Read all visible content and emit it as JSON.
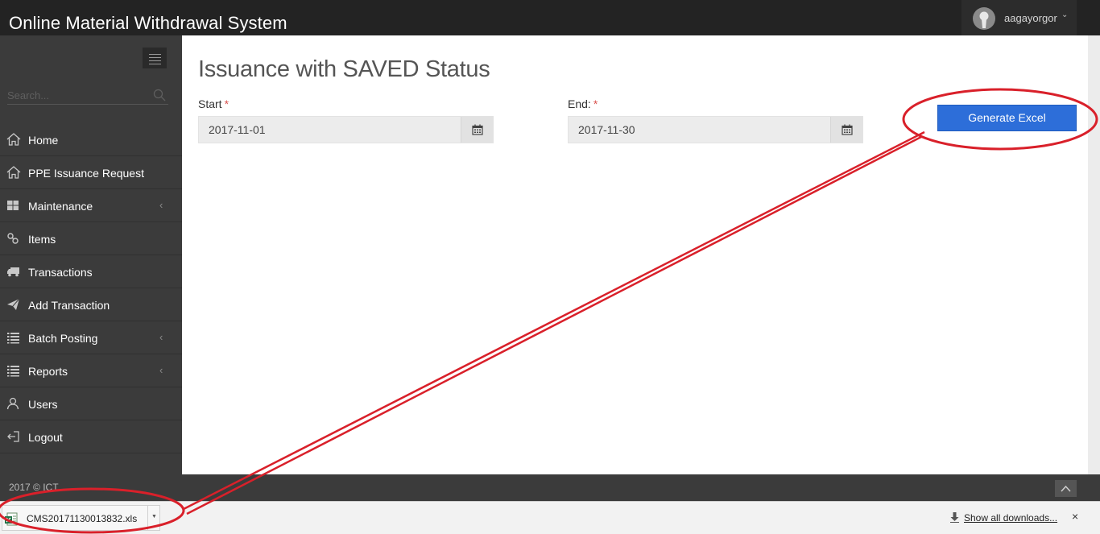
{
  "app_title": "Online Material Withdrawal System",
  "user": {
    "name": "aagayorgor"
  },
  "sidebar": {
    "search_placeholder": "Search...",
    "items": [
      {
        "label": "Home",
        "icon": "home-icon",
        "has_submenu": false
      },
      {
        "label": "PPE Issuance Request",
        "icon": "home-icon",
        "has_submenu": false
      },
      {
        "label": "Maintenance",
        "icon": "grid-icon",
        "has_submenu": true
      },
      {
        "label": "Items",
        "icon": "link-icon",
        "has_submenu": false
      },
      {
        "label": "Transactions",
        "icon": "truck-icon",
        "has_submenu": false
      },
      {
        "label": "Add Transaction",
        "icon": "paper-plane-icon",
        "has_submenu": false
      },
      {
        "label": "Batch Posting",
        "icon": "list-icon",
        "has_submenu": true
      },
      {
        "label": "Reports",
        "icon": "list-icon",
        "has_submenu": true
      },
      {
        "label": "Users",
        "icon": "users-icon",
        "has_submenu": false
      },
      {
        "label": "Logout",
        "icon": "logout-icon",
        "has_submenu": false
      }
    ]
  },
  "main": {
    "title": "Issuance with SAVED Status",
    "start": {
      "label": "Start",
      "required_mark": "*",
      "value": "2017-11-01"
    },
    "end": {
      "label": "End:",
      "required_mark": "*",
      "value": "2017-11-30"
    },
    "generate_label": "Generate Excel"
  },
  "footer": {
    "text": "2017 © ICT."
  },
  "downloads": {
    "file_name": "CMS20171130013832.xls",
    "show_all_label": "Show all downloads...",
    "close_label": "×"
  },
  "colors": {
    "topbar": "#232323",
    "sidebar": "#3b3b3b",
    "accent_button": "#2d6ed9",
    "annotation": "#d9202a",
    "required": "#d9534f"
  }
}
